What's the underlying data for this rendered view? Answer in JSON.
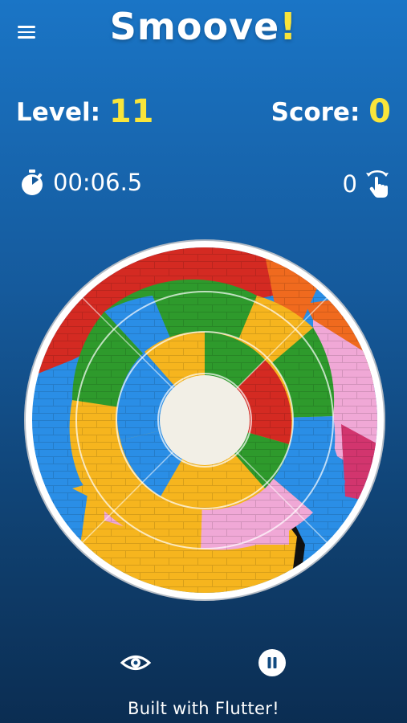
{
  "header": {
    "title": "Smoove",
    "title_accent": "!"
  },
  "stats": {
    "level_label": "Level:",
    "level_value": "11",
    "score_label": "Score:",
    "score_value": "0",
    "timer": "00:06.5",
    "moves": "0"
  },
  "icons": {
    "menu": "hamburger-menu-icon",
    "timer": "stopwatch-icon",
    "moves": "tap-rotate-icon",
    "preview": "eye-icon",
    "pause": "pause-icon"
  },
  "colors": {
    "accent": "#f9e53a",
    "background_top": "#1a75c6",
    "background_bottom": "#0b2d52",
    "puzzle_red": "#d42a22",
    "puzzle_green": "#2e9a2c",
    "puzzle_blue": "#2a8ee6",
    "puzzle_yellow": "#f6b51e",
    "puzzle_pink": "#f0a8d6",
    "puzzle_orange": "#f06a1e"
  },
  "footer": {
    "text": "Built with Flutter!"
  }
}
